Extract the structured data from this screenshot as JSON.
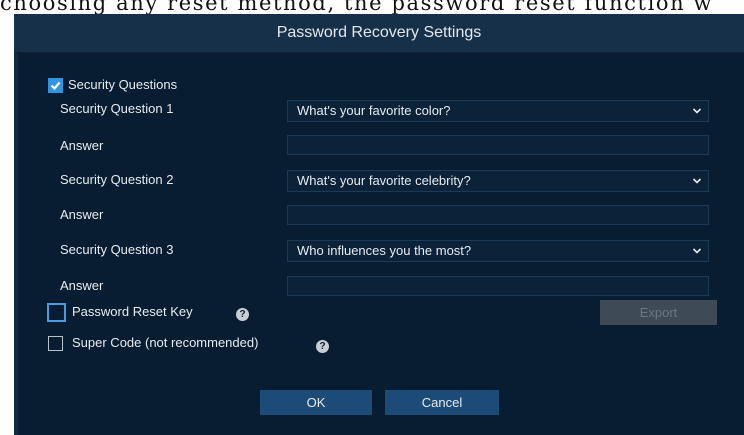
{
  "doc_text": "choosing any reset method, the password reset function w",
  "dialog": {
    "title": "Password Recovery Settings"
  },
  "security_questions": {
    "checkbox_label": "Security Questions",
    "checked": true,
    "questions": [
      {
        "label": "Security Question 1",
        "selected": "What's your favorite color?",
        "answer_label": "Answer",
        "answer_value": ""
      },
      {
        "label": "Security Question 2",
        "selected": "What's your favorite celebrity?",
        "answer_label": "Answer",
        "answer_value": ""
      },
      {
        "label": "Security Question 3",
        "selected": "Who influences you the most?",
        "answer_label": "Answer",
        "answer_value": ""
      }
    ]
  },
  "reset_key": {
    "label": "Password Reset Key",
    "checked": false,
    "export_label": "Export",
    "export_enabled": false
  },
  "super_code": {
    "label": "Super Code (not recommended)",
    "checked": false
  },
  "buttons": {
    "ok": "OK",
    "cancel": "Cancel"
  },
  "icons": {
    "help": "help-icon",
    "dropdown": "chevron-down-icon",
    "check": "checkmark-icon"
  },
  "colors": {
    "dialog_bg": "#081d31",
    "title_bar": "#173049",
    "accent": "#2f95e2",
    "button": "#1d4b78",
    "disabled_button": "#3e4a56"
  }
}
